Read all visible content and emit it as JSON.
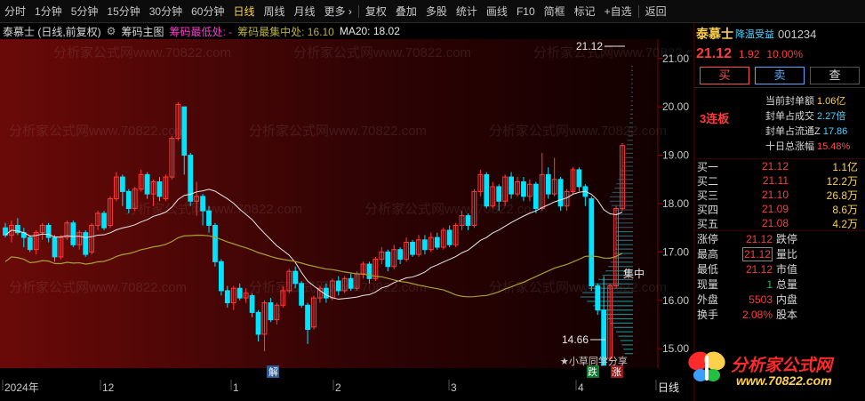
{
  "toolbar": {
    "items": [
      "分时",
      "1分钟",
      "5分钟",
      "15分钟",
      "30分钟",
      "60分钟",
      "日线",
      "周线",
      "月线",
      "更多 ›",
      "复权",
      "叠加",
      "多股",
      "统计",
      "画线",
      "F10",
      "简框",
      "标记",
      "+自选",
      "返回"
    ],
    "active_index": 6
  },
  "title_bar": {
    "stock_period": "泰慕士 (日线,前复权)",
    "indicator": "筹码主图",
    "low_label": "筹码最低处: -",
    "max_label": "筹码最集中处: 16.10",
    "ma_label": "MA20: 18.02"
  },
  "colors": {
    "up": "#ff3b3b",
    "down": "#00e5ff",
    "ma20": "#e8e8e8",
    "cost": "#a8a030",
    "accent": "#ffd04a"
  },
  "chart": {
    "y_ticks": [
      "21.00",
      "20.00",
      "19.00",
      "18.00",
      "17.00",
      "16.00",
      "15.00"
    ],
    "x_labels": [
      "2024年",
      "12",
      "1",
      "2",
      "3",
      "4",
      "日线"
    ],
    "annotation_high": "21.12",
    "annotation_low": "14.66",
    "concentration_label": "集中",
    "watermark": "分析家公式网www.70822.com",
    "xiaocao": "★小草同学分享",
    "jie_label": "解",
    "die_label": "跌",
    "zhang_label": "涨"
  },
  "chart_data": {
    "type": "candlestick",
    "ylim": [
      14.6,
      21.4
    ],
    "candles": [
      [
        17.5,
        17.35,
        17.6,
        17.3
      ],
      [
        17.35,
        17.55,
        17.65,
        17.2
      ],
      [
        17.55,
        17.4,
        17.7,
        17.35
      ],
      [
        17.4,
        17.3,
        17.5,
        17.1
      ],
      [
        17.3,
        17.05,
        17.35,
        17.0
      ],
      [
        17.05,
        17.4,
        17.45,
        16.95
      ],
      [
        17.4,
        17.55,
        17.6,
        17.25
      ],
      [
        17.55,
        17.3,
        17.6,
        17.2
      ],
      [
        17.3,
        16.9,
        17.35,
        16.8
      ],
      [
        16.9,
        17.3,
        17.35,
        16.85
      ],
      [
        17.3,
        17.6,
        17.65,
        17.25
      ],
      [
        17.6,
        17.15,
        17.65,
        17.1
      ],
      [
        17.15,
        17.4,
        17.45,
        17.05
      ],
      [
        17.4,
        16.95,
        17.45,
        16.9
      ],
      [
        17.0,
        17.55,
        17.6,
        16.95
      ],
      [
        17.55,
        17.8,
        17.85,
        17.45
      ],
      [
        17.8,
        17.5,
        17.85,
        17.45
      ],
      [
        17.55,
        18.1,
        18.15,
        17.5
      ],
      [
        18.1,
        18.55,
        18.65,
        18.05
      ],
      [
        18.55,
        18.25,
        18.6,
        17.95
      ],
      [
        18.25,
        17.9,
        18.3,
        17.8
      ],
      [
        17.9,
        18.3,
        18.35,
        17.85
      ],
      [
        18.3,
        18.6,
        18.7,
        18.25
      ],
      [
        18.6,
        18.2,
        18.65,
        18.1
      ],
      [
        18.2,
        18.45,
        18.5,
        17.95
      ],
      [
        18.45,
        18.15,
        18.55,
        18.05
      ],
      [
        18.1,
        18.55,
        18.6,
        18.05
      ],
      [
        18.55,
        19.35,
        19.4,
        18.5
      ],
      [
        19.35,
        20.05,
        20.1,
        19.3
      ],
      [
        20.0,
        19.0,
        20.0,
        18.6
      ],
      [
        19.0,
        18.05,
        19.05,
        17.95
      ],
      [
        18.05,
        18.15,
        18.45,
        17.75
      ],
      [
        18.15,
        17.85,
        18.2,
        17.55
      ],
      [
        17.85,
        17.55,
        17.95,
        17.4
      ],
      [
        17.55,
        16.8,
        17.6,
        16.7
      ],
      [
        16.8,
        16.2,
        16.85,
        16.1
      ],
      [
        16.2,
        15.95,
        16.3,
        15.85
      ],
      [
        15.95,
        16.25,
        16.3,
        15.8
      ],
      [
        16.25,
        16.05,
        16.35,
        16.0
      ],
      [
        16.05,
        16.15,
        16.25,
        15.95
      ],
      [
        16.1,
        15.75,
        16.15,
        15.65
      ],
      [
        15.75,
        15.3,
        15.8,
        15.15
      ],
      [
        15.3,
        15.95,
        16.0,
        14.95
      ],
      [
        15.95,
        15.6,
        16.05,
        15.55
      ],
      [
        15.6,
        15.9,
        15.95,
        15.5
      ],
      [
        15.9,
        16.2,
        16.3,
        15.85
      ],
      [
        16.2,
        16.6,
        16.65,
        16.15
      ],
      [
        16.6,
        16.35,
        16.7,
        16.25
      ],
      [
        16.35,
        15.9,
        16.4,
        15.85
      ],
      [
        15.9,
        15.4,
        15.95,
        15.1
      ],
      [
        15.45,
        16.05,
        16.1,
        15.4
      ],
      [
        16.05,
        16.25,
        16.3,
        15.95
      ],
      [
        16.25,
        16.05,
        16.35,
        15.95
      ],
      [
        16.05,
        16.4,
        16.45,
        16.0
      ],
      [
        16.4,
        16.2,
        16.5,
        16.1
      ],
      [
        16.2,
        16.45,
        16.5,
        16.15
      ],
      [
        16.45,
        16.25,
        16.55,
        16.2
      ],
      [
        16.25,
        16.55,
        16.6,
        16.2
      ],
      [
        16.55,
        16.75,
        16.8,
        16.45
      ],
      [
        16.75,
        16.45,
        16.8,
        16.35
      ],
      [
        16.45,
        16.85,
        16.9,
        16.4
      ],
      [
        16.85,
        17.0,
        17.1,
        16.75
      ],
      [
        17.0,
        16.7,
        17.05,
        16.6
      ],
      [
        16.7,
        17.05,
        17.15,
        16.65
      ],
      [
        17.05,
        16.85,
        17.1,
        16.75
      ],
      [
        16.85,
        17.2,
        17.3,
        16.8
      ],
      [
        17.2,
        16.95,
        17.25,
        16.9
      ],
      [
        16.95,
        17.25,
        17.35,
        16.9
      ],
      [
        17.25,
        17.05,
        17.35,
        16.95
      ],
      [
        17.05,
        17.3,
        17.4,
        17.0
      ],
      [
        17.3,
        17.1,
        17.4,
        17.05
      ],
      [
        17.1,
        17.45,
        17.5,
        17.05
      ],
      [
        17.45,
        17.15,
        17.55,
        17.1
      ],
      [
        17.15,
        17.55,
        17.6,
        17.1
      ],
      [
        17.55,
        17.75,
        17.85,
        17.45
      ],
      [
        17.75,
        17.55,
        17.8,
        17.45
      ],
      [
        17.55,
        18.25,
        18.3,
        17.5
      ],
      [
        18.25,
        18.6,
        18.7,
        18.15
      ],
      [
        18.6,
        17.95,
        18.65,
        17.9
      ],
      [
        17.95,
        18.35,
        18.45,
        17.9
      ],
      [
        18.35,
        18.05,
        18.4,
        17.85
      ],
      [
        18.05,
        18.55,
        18.6,
        17.95
      ],
      [
        18.55,
        18.2,
        18.65,
        18.1
      ],
      [
        18.2,
        18.45,
        18.55,
        18.15
      ],
      [
        18.45,
        18.15,
        18.55,
        18.05
      ],
      [
        18.15,
        18.4,
        18.5,
        18.05
      ],
      [
        18.4,
        17.9,
        18.45,
        17.8
      ],
      [
        17.9,
        18.6,
        19.05,
        17.85
      ],
      [
        18.6,
        18.2,
        18.75,
        18.1
      ],
      [
        18.2,
        18.5,
        18.95,
        18.15
      ],
      [
        18.5,
        17.95,
        18.55,
        17.85
      ],
      [
        17.95,
        18.25,
        18.3,
        17.85
      ],
      [
        18.25,
        18.7,
        18.75,
        18.2
      ],
      [
        18.7,
        18.35,
        18.75,
        18.25
      ],
      [
        18.35,
        18.15,
        18.4,
        17.95
      ],
      [
        18.1,
        16.3,
        18.15,
        16.2
      ],
      [
        16.3,
        15.8,
        16.35,
        15.7
      ],
      [
        15.8,
        14.66,
        16.5,
        14.66
      ],
      [
        14.8,
        16.3,
        16.35,
        14.75
      ],
      [
        16.3,
        17.9,
        17.95,
        16.25
      ],
      [
        17.9,
        19.2,
        19.25,
        17.85
      ]
    ],
    "ma20_label": "MA20",
    "profile_peak": 16.1
  },
  "right_panel": {
    "name": "泰慕士",
    "badge": "降温受益",
    "code": "001234",
    "price": "21.12",
    "change": "1.92",
    "change_pct": "10.00%",
    "buy": "买",
    "sell": "卖",
    "query": "查",
    "lianban": "3连板",
    "seal": [
      {
        "k": "当前封单额",
        "v": "1.06亿",
        "c": "y"
      },
      {
        "k": "封单占成交",
        "v": "2.27倍",
        "c": "c"
      },
      {
        "k": "封单占流通Z",
        "v": "17.86",
        "c": "c"
      },
      {
        "k": "十日总涨幅",
        "v": "15.48%",
        "c": "r"
      }
    ],
    "orderbook": [
      {
        "k": "买一",
        "p": "21.12",
        "v": "1.1亿"
      },
      {
        "k": "买二",
        "p": "21.11",
        "v": "12.2万"
      },
      {
        "k": "买三",
        "p": "21.10",
        "v": "26.8万"
      },
      {
        "k": "买四",
        "p": "21.09",
        "v": "8.6万"
      },
      {
        "k": "买五",
        "p": "21.08",
        "v": "4.2万"
      }
    ],
    "stats": [
      {
        "k": "涨停",
        "v": "21.12",
        "k2": "跌停"
      },
      {
        "k": "最高",
        "v": "21.12",
        "k2": "量比",
        "boxed": true
      },
      {
        "k": "最低",
        "v": "21.12",
        "k2": "市值"
      },
      {
        "k": "现量",
        "v": "1",
        "k2": "总量"
      },
      {
        "k": "外盘",
        "v": "5503",
        "k2": "内盘"
      },
      {
        "k": "换手",
        "v": "2.08%",
        "k2": "股本"
      }
    ],
    "logo_text": "分析家公式网",
    "logo_url": "www.70822.com"
  }
}
